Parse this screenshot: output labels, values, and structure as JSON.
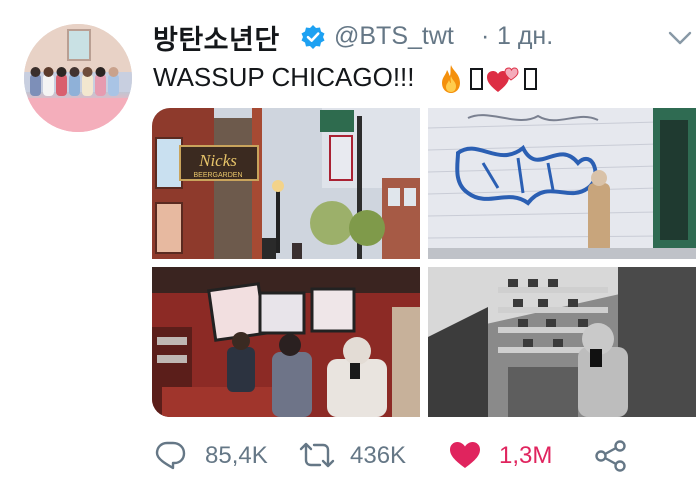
{
  "tweet": {
    "display_name": "방탄소년단",
    "handle": "@BTS_twt",
    "separator": "·",
    "time": "1 дн.",
    "text": "WASSUP CHICAGO!!!",
    "emojis": [
      "fire",
      "unrendered-glyph",
      "two-hearts",
      "unrendered-glyph"
    ],
    "accent_color": "#1da1f2",
    "like_color": "#e0245e"
  },
  "media": {
    "images": [
      {
        "subject": "Street with 'Nick's Beergarden' sign"
      },
      {
        "subject": "Graffiti wall with person in trench coat"
      },
      {
        "subject": "Mirror selfie in red shoe store"
      },
      {
        "subject": "Black and white mirror selfie in store"
      }
    ],
    "sign_text": "Nicks",
    "sign_subtext": "BEERGARDEN"
  },
  "actions": {
    "reply_count": "85,4K",
    "retweet_count": "436K",
    "like_count": "1,3M"
  }
}
